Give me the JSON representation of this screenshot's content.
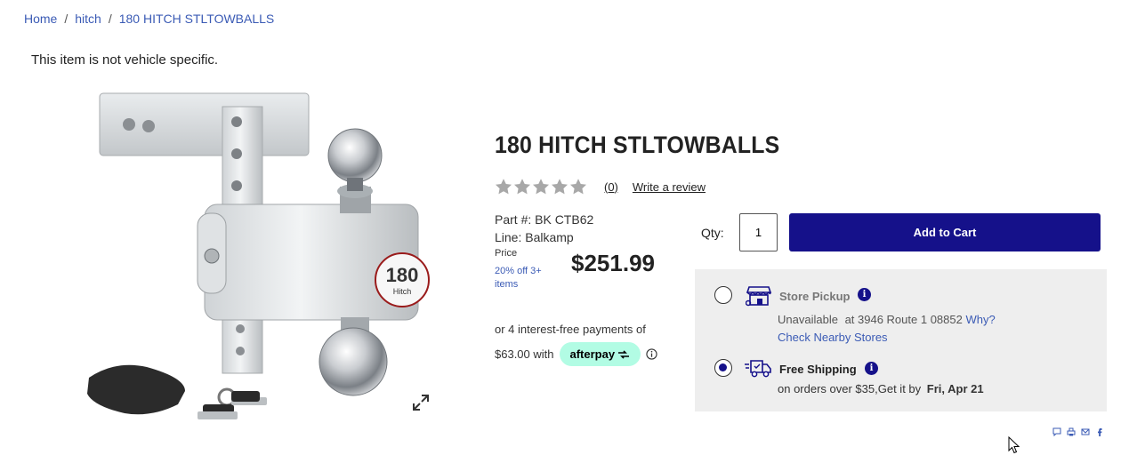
{
  "breadcrumb": {
    "items": [
      "Home",
      "hitch",
      "180 HITCH STLTOWBALLS"
    ],
    "separator": "/"
  },
  "vehicle_note": "This item is not vehicle specific.",
  "product": {
    "title": "180 HITCH STLTOWBALLS",
    "rating_count": "(0)",
    "stars": 0,
    "write_review": "Write a review",
    "part_number": "Part #: BK CTB62",
    "line": "Line: Balkamp",
    "price_label": "Price",
    "discount": "20% off 3+ items",
    "price": "$251.99",
    "image_badge_text": "180 Hitch"
  },
  "afterpay": {
    "line1": "or 4 interest-free payments of",
    "line2": "$63.00 with",
    "badge": "afterpay"
  },
  "cart": {
    "qty_label": "Qty:",
    "qty_value": "1",
    "add_label": "Add to Cart",
    "button_color": "#15118a"
  },
  "fulfillment": {
    "pickup": {
      "title": "Store Pickup",
      "status": "Unavailable",
      "location": "at 3946 Route 1 08852",
      "why": "Why?",
      "nearby": "Check Nearby Stores",
      "selected": false
    },
    "shipping": {
      "title": "Free Shipping",
      "detail": "on orders over $35,Get it by",
      "date": "Fri, Apr 21",
      "selected": true
    }
  },
  "share_icons": [
    "comment-icon",
    "print-icon",
    "mail-icon",
    "facebook-icon"
  ]
}
